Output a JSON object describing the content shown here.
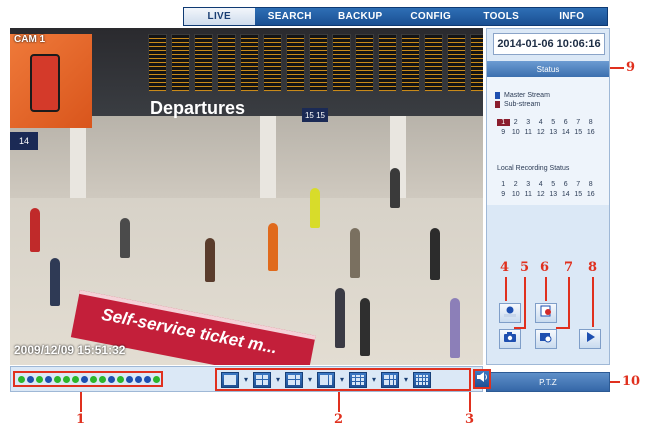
{
  "nav": {
    "tabs": [
      "LIVE",
      "SEARCH",
      "BACKUP",
      "CONFIG",
      "TOOLS",
      "INFO"
    ],
    "active": "LIVE"
  },
  "video": {
    "camera_label": "CAM 1",
    "board_text": "Departures",
    "platform_sign": "14",
    "platform_sign_2": "15 15",
    "banner_text": "Self-service ticket m...",
    "timestamp": "2009/12/09 15:51:32"
  },
  "panel": {
    "datetime": "2014-01-06 10:06:16",
    "status_label": "Status",
    "legend_master": "Master Stream",
    "legend_sub": "Sub-stream",
    "stream_channels": [
      "1",
      "2",
      "3",
      "4",
      "5",
      "6",
      "7",
      "8",
      "9",
      "10",
      "11",
      "12",
      "13",
      "14",
      "15",
      "16"
    ],
    "active_channel": "1",
    "rec_status_label": "Local Recording Status",
    "rec_channels": [
      "1",
      "2",
      "3",
      "4",
      "5",
      "6",
      "7",
      "8",
      "9",
      "10",
      "11",
      "12",
      "13",
      "14",
      "15",
      "16"
    ],
    "ptz_label": "P.T.Z",
    "colors": {
      "master": "#1e4fb0",
      "sub": "#8a1e2e"
    }
  },
  "bottom": {
    "channel_dot_colors": [
      "#2cb52c",
      "#1e4fb0",
      "#2cb52c",
      "#1e4fb0",
      "#2cb52c",
      "#2cb52c",
      "#2cb52c",
      "#1e4fb0",
      "#2cb52c",
      "#2cb52c",
      "#1e4fb0",
      "#2cb52c",
      "#1e4fb0",
      "#1e4fb0",
      "#1e4fb0",
      "#2cb52c"
    ],
    "layouts": [
      "1x1",
      "2x2",
      "3x3-a",
      "3x3-b",
      "4x4",
      "5x5",
      "6x6"
    ]
  },
  "callouts": [
    "1",
    "2",
    "3",
    "4",
    "5",
    "6",
    "7",
    "8",
    "9",
    "10"
  ],
  "icons": {
    "record": "record-icon",
    "snapshot": "camera-icon",
    "manual_record": "manual-record-icon",
    "zoom": "zoom-icon",
    "play": "play-icon",
    "audio": "speaker-icon"
  }
}
